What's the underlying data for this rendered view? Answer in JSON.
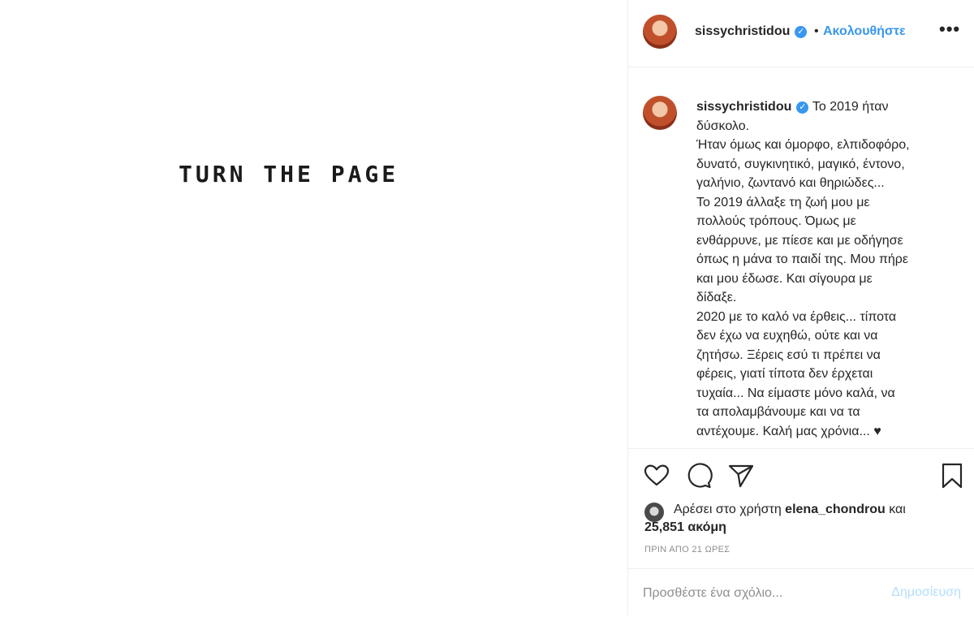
{
  "media": {
    "text": "TURN THE PAGE"
  },
  "header": {
    "username": "sissychristidou",
    "verified_glyph": "✓",
    "separator": "•",
    "follow_label": "Ακολουθήστε",
    "more_glyph": "•••",
    "more_icon": "more-options-icon"
  },
  "caption": {
    "username": "sissychristidou",
    "verified_glyph": "✓",
    "lines": [
      "Το 2019 ήταν",
      "δύσκολο.",
      "Ήταν όμως και όμορφο, ελπιδοφόρο,",
      "δυνατό, συγκινητικό, μαγικό, έντονο,",
      "γαλήνιο, ζωντανό και θηριώδες...",
      "Το 2019 άλλαξε τη ζωή μου με",
      "πολλούς τρόπους. Όμως με",
      "ενθάρρυνε, με πίεσε και με οδήγησε",
      "όπως η μάνα το παιδί της. Μου πήρε",
      "και μου έδωσε. Και σίγουρα με",
      "δίδαξε.",
      "2020 με το καλό να έρθεις... τίποτα",
      "δεν έχω να ευχηθώ, ούτε και να",
      "ζητήσω. Ξέρεις εσύ τι πρέπει να",
      "φέρεις, γιατί τίποτα δεν έρχεται",
      "τυχαία... Να είμαστε μόνο καλά, να",
      "τα απολαμβάνουμε και να τα",
      "αντέχουμε. Καλή μας χρόνια... ♥"
    ]
  },
  "actions": {
    "icons": [
      "heart-icon",
      "comment-icon",
      "share-icon",
      "bookmark-icon"
    ]
  },
  "likes": {
    "prefix": "Αρέσει στο χρήστη ",
    "user": "elena_chondrou",
    "middle": " και",
    "count": "25,851 ακόμη"
  },
  "timestamp": "ΠΡΙΝ ΑΠΟ 21 ΩΡΕΣ",
  "comment": {
    "placeholder": "Προσθέστε ένα σχόλιο...",
    "post_label": "Δημοσίευση"
  },
  "colors": {
    "link_blue": "#3897f0",
    "post_disabled": "#b2dffc",
    "muted_gray": "#8e8e8e",
    "text": "#262626",
    "border": "#efefef"
  }
}
